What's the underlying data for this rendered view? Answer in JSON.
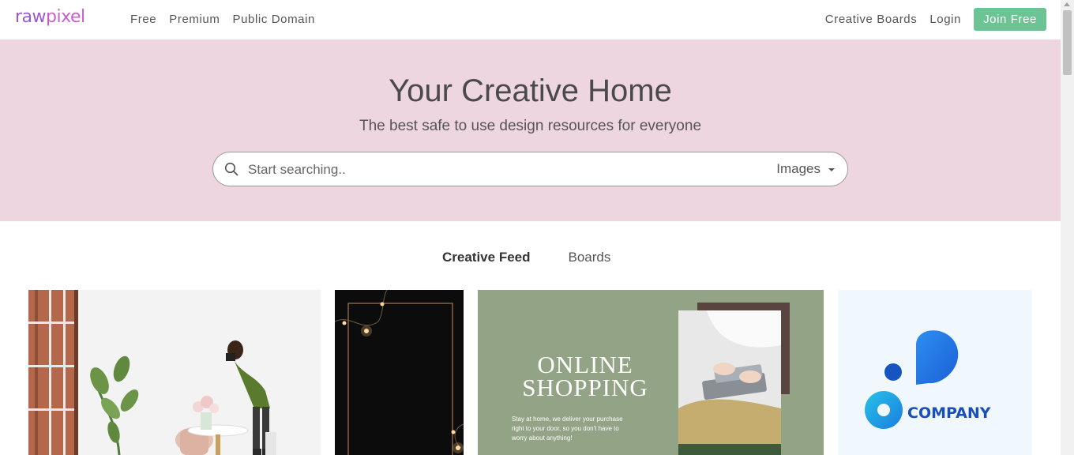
{
  "brand": {
    "logo_prefix": "raw",
    "logo_suffix": "pixel"
  },
  "nav": {
    "left_links": [
      "Free",
      "Premium",
      "Public Domain"
    ],
    "creative_boards": "Creative Boards",
    "login": "Login",
    "join": "Join Free"
  },
  "hero": {
    "title": "Your Creative Home",
    "subtitle": "The best safe to use design resources for everyone",
    "search_placeholder": "Start searching..",
    "search_type": "Images"
  },
  "tabs": {
    "feed": "Creative Feed",
    "boards": "Boards"
  },
  "cards": {
    "shopping": {
      "title_line1": "ONLINE",
      "title_line2": "SHOPPING",
      "body_line1": "Stay at home, we deliver your purchase",
      "body_line2": "right to your door, so you don't have to",
      "body_line3": "worry about anything!"
    },
    "company": {
      "label": "COMPANY"
    }
  },
  "colors": {
    "hero_bg": "#eed6e1",
    "join_button": "#6cc494",
    "logo": "#9b59d0",
    "shopping_bg": "#93a385"
  }
}
